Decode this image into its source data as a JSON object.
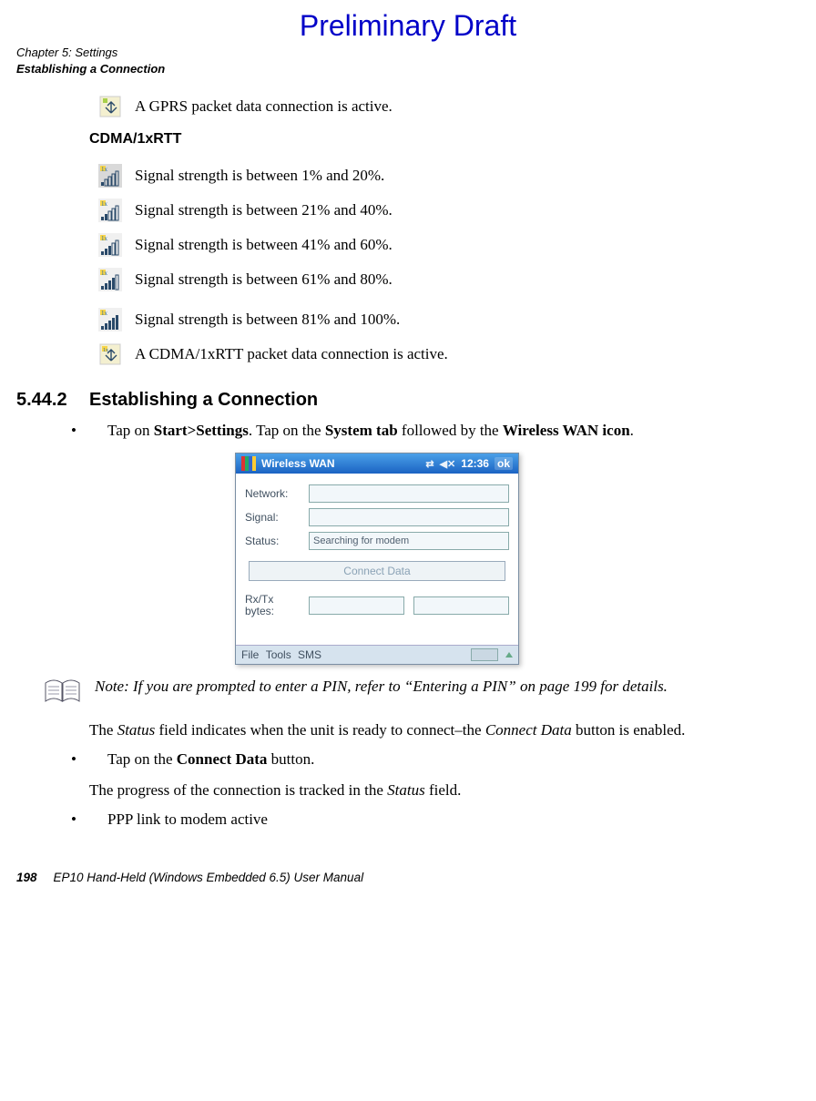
{
  "watermark": "Preliminary Draft",
  "header": {
    "chapter": "Chapter 5: Settings",
    "section": "Establishing a Connection"
  },
  "icons": {
    "gprs_active": "A GPRS packet data connection is active.",
    "cdma_heading": "CDMA/1xRTT",
    "sig_1_20": "Signal strength is between 1% and 20%.",
    "sig_21_40": "Signal strength is between 21% and 40%.",
    "sig_41_60": "Signal strength is between 41% and 60%.",
    "sig_61_80": "Signal strength is between 61% and 80%.",
    "sig_81_100": "Signal strength is between 81% and 100%.",
    "cdma_active": "A CDMA/1xRTT packet data connection is active."
  },
  "section": {
    "number": "5.44.2",
    "title": "Establishing a Connection",
    "step1_pre": "Tap on ",
    "step1_b1": "Start>Settings",
    "step1_mid": ". Tap on the ",
    "step1_b2": "System tab",
    "step1_mid2": " followed by the ",
    "step1_b3": "Wireless WAN icon",
    "step1_post": "."
  },
  "screenshot": {
    "title": "Wireless WAN",
    "time": "12:36",
    "ok": "ok",
    "labels": {
      "network": "Network:",
      "signal": "Signal:",
      "status": "Status:",
      "rxtx": "Rx/Tx bytes:"
    },
    "status_value": "Searching for modem",
    "connect_btn": "Connect Data",
    "menu": {
      "file": "File",
      "tools": "Tools",
      "sms": "SMS"
    }
  },
  "note": {
    "text": "Note: If you are prompted to enter a PIN, refer to “Entering a PIN” on page 199 for details."
  },
  "body": {
    "p1_pre": "The ",
    "p1_i1": "Status",
    "p1_mid": " field indicates when the unit is ready to connect–the ",
    "p1_i2": "Connect Data",
    "p1_post": " button is enabled.",
    "step2_pre": "Tap on the ",
    "step2_b": "Connect Data",
    "step2_post": " button.",
    "p2_pre": "The progress of the connection is tracked in the ",
    "p2_i": "Status",
    "p2_post": " field.",
    "step3": "PPP link to modem active"
  },
  "footer": {
    "page": "198",
    "manual": "EP10 Hand-Held (Windows Embedded 6.5) User Manual"
  }
}
